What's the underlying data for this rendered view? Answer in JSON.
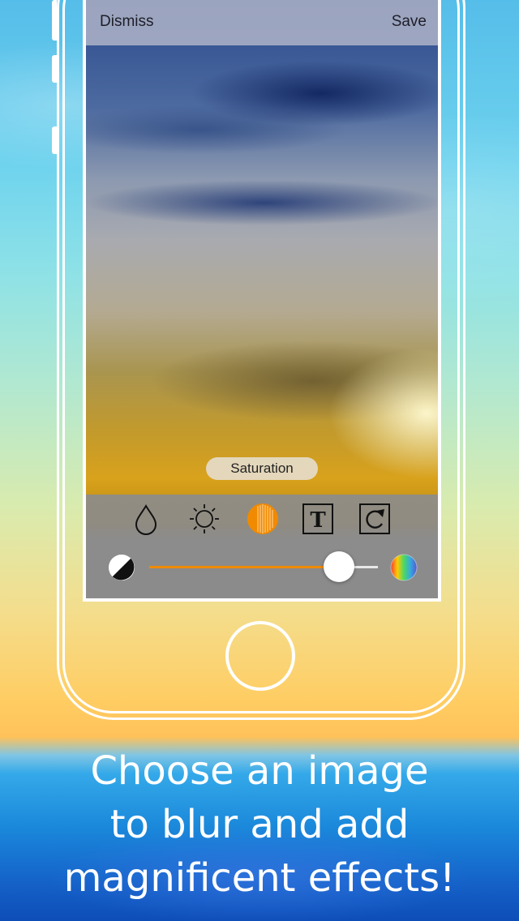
{
  "topbar": {
    "dismiss_label": "Dismiss",
    "save_label": "Save"
  },
  "adjustment": {
    "label": "Saturation",
    "slider_value": 0.83
  },
  "tools": [
    {
      "icon": "droplet-icon",
      "name": "blur"
    },
    {
      "icon": "sun-icon",
      "name": "brightness"
    },
    {
      "icon": "saturation-icon",
      "name": "saturation",
      "active": true
    },
    {
      "icon": "text-icon",
      "name": "text"
    },
    {
      "icon": "rotate-icon",
      "name": "rotate"
    }
  ],
  "slider": {
    "min_icon": "contrast-icon",
    "max_icon": "color-wheel-icon"
  },
  "colors": {
    "accent": "#f08a00"
  },
  "caption": {
    "line1": "Choose an image",
    "line2": "to blur and add",
    "line3": "magnificent effects!"
  }
}
